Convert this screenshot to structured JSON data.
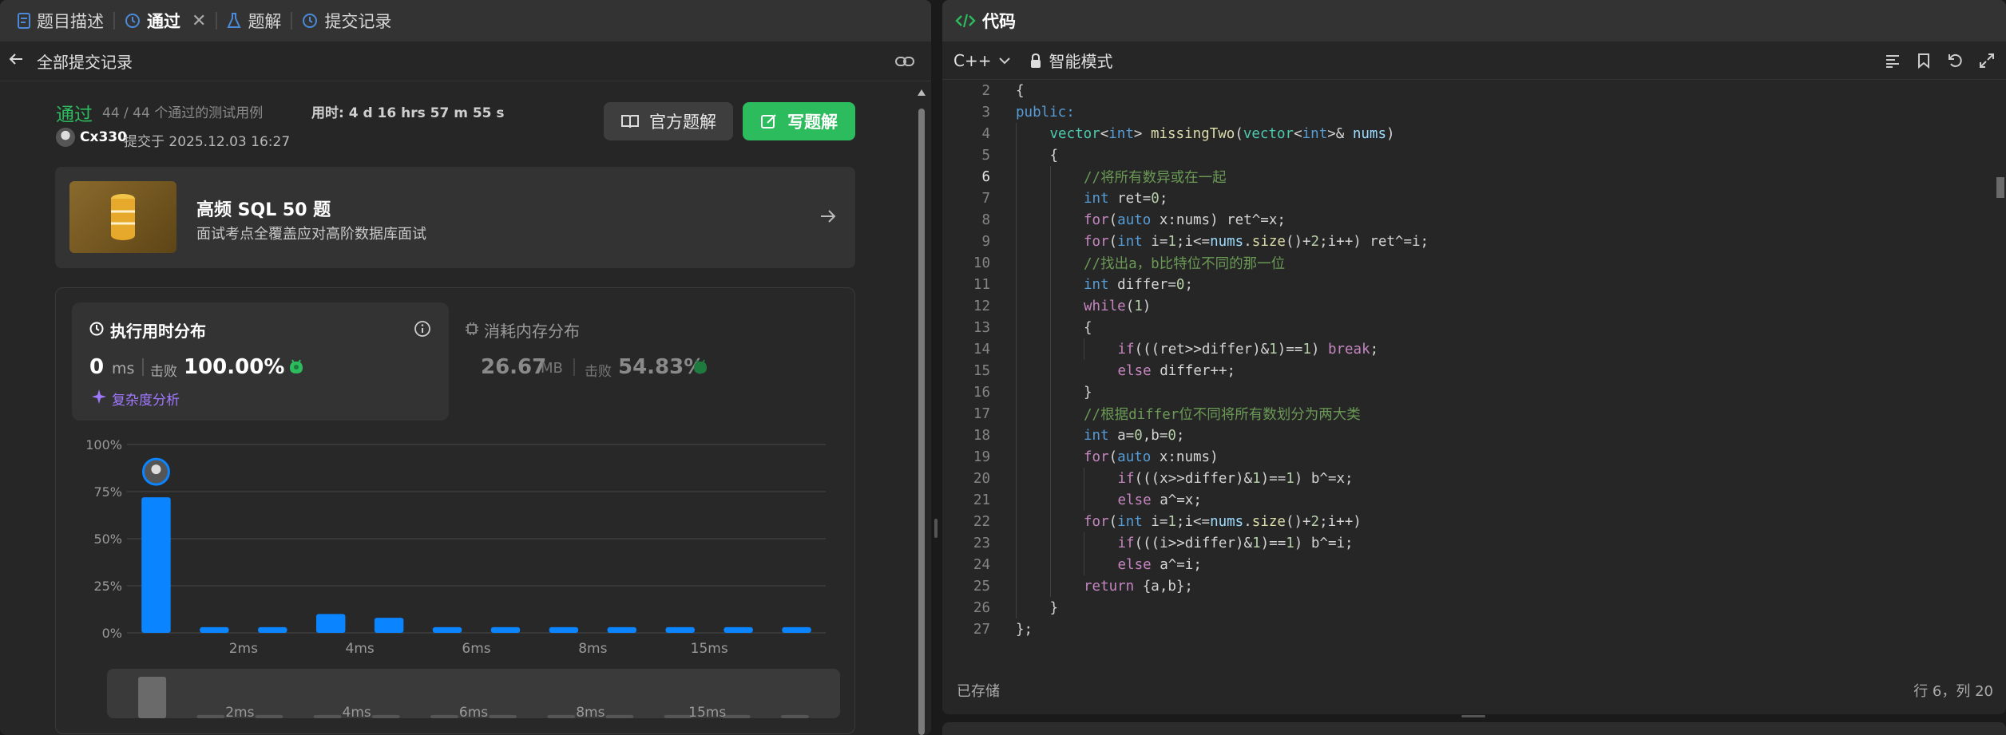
{
  "left_tabs": [
    {
      "label": "题目描述",
      "icon": "description-icon"
    },
    {
      "label": "通过",
      "icon": "history-icon",
      "active": true
    },
    {
      "label": "题解",
      "icon": "flask-icon"
    },
    {
      "label": "提交记录",
      "icon": "history-icon"
    }
  ],
  "sub_header": {
    "back_label": "全部提交记录"
  },
  "result": {
    "status": "通过",
    "cases": "44 / 44 个通过的测试用例",
    "time_taken": "用时: 4 d 16 hrs 57 m 55 s",
    "user": "Cx330",
    "submitted_at": "提交于 2025.12.03 16:27"
  },
  "buttons": {
    "official": "官方题解",
    "write": "写题解"
  },
  "promo": {
    "title": "高频 SQL 50 题",
    "desc": "面试考点全覆盖应对高阶数据库面试"
  },
  "runtime": {
    "title": "执行用时分布",
    "value": "0",
    "unit": "ms",
    "beats_label": "击败",
    "beats": "100.00%",
    "complexity": "复杂度分析"
  },
  "memory": {
    "title": "消耗内存分布",
    "value": "26.67",
    "unit": "MB",
    "beats_label": "击败",
    "beats": "54.83%"
  },
  "chart_data": {
    "type": "bar",
    "y_ticks": [
      "100%",
      "75%",
      "50%",
      "25%",
      "0%"
    ],
    "ylim": [
      0,
      100
    ],
    "values": [
      72,
      3,
      3,
      10,
      8,
      3,
      3,
      3,
      3,
      3,
      3,
      3
    ],
    "x_tick_labels": [
      "2ms",
      "4ms",
      "6ms",
      "8ms",
      "15ms"
    ],
    "x_tick_positions": [
      2,
      4,
      6,
      8,
      10
    ],
    "highlight_index": 0,
    "bar_color": "#0a84ff",
    "grid": true
  },
  "mini_chart": {
    "values": [
      100,
      8,
      8,
      8,
      8,
      8,
      8,
      8,
      8,
      8,
      8,
      8
    ],
    "x_tick_labels": [
      "2ms",
      "4ms",
      "6ms",
      "8ms",
      "15ms"
    ]
  },
  "code_panel": {
    "title": "代码",
    "language": "C++",
    "mode": "智能模式",
    "saved": "已存储",
    "cursor": "行 6，列 20"
  },
  "code_lines": [
    {
      "n": "2",
      "indent": 0,
      "segs": [
        [
          "{",
          "#d4d4d4"
        ]
      ]
    },
    {
      "n": "3",
      "indent": 0,
      "segs": [
        [
          "public:",
          "#569cd6"
        ]
      ]
    },
    {
      "n": "4",
      "indent": 1,
      "segs": [
        [
          "vector",
          "#4ec9b0"
        ],
        [
          "<",
          "#d4d4d4"
        ],
        [
          "int",
          "#569cd6"
        ],
        [
          "> ",
          "#d4d4d4"
        ],
        [
          "missingTwo",
          "#dcdcaa"
        ],
        [
          "(",
          "#d4d4d4"
        ],
        [
          "vector",
          "#4ec9b0"
        ],
        [
          "<",
          "#d4d4d4"
        ],
        [
          "int",
          "#569cd6"
        ],
        [
          ">& ",
          "#d4d4d4"
        ],
        [
          "nums",
          "#9cdcfe"
        ],
        [
          ")",
          "#d4d4d4"
        ]
      ]
    },
    {
      "n": "5",
      "indent": 1,
      "segs": [
        [
          "{",
          "#d4d4d4"
        ]
      ]
    },
    {
      "n": "6",
      "indent": 2,
      "active": true,
      "segs": [
        [
          "//将所有数异或在一起",
          "#6a9955"
        ]
      ]
    },
    {
      "n": "7",
      "indent": 2,
      "segs": [
        [
          "int",
          "#569cd6"
        ],
        [
          " ret=",
          "#d4d4d4"
        ],
        [
          "0",
          "#b5cea8"
        ],
        [
          ";",
          "#d4d4d4"
        ]
      ]
    },
    {
      "n": "8",
      "indent": 2,
      "segs": [
        [
          "for",
          "#c586c0"
        ],
        [
          "(",
          "#d4d4d4"
        ],
        [
          "auto",
          "#569cd6"
        ],
        [
          " x:nums) ret^=x;",
          "#d4d4d4"
        ]
      ]
    },
    {
      "n": "9",
      "indent": 2,
      "segs": [
        [
          "for",
          "#c586c0"
        ],
        [
          "(",
          "#d4d4d4"
        ],
        [
          "int",
          "#569cd6"
        ],
        [
          " i=",
          "#d4d4d4"
        ],
        [
          "1",
          "#b5cea8"
        ],
        [
          ";i<=",
          "#d4d4d4"
        ],
        [
          "nums",
          "#9cdcfe"
        ],
        [
          ".",
          "#d4d4d4"
        ],
        [
          "size",
          "#dcdcaa"
        ],
        [
          "()+",
          "#d4d4d4"
        ],
        [
          "2",
          "#b5cea8"
        ],
        [
          ";i++) ret^=i;",
          "#d4d4d4"
        ]
      ]
    },
    {
      "n": "10",
      "indent": 2,
      "segs": [
        [
          "//找出a，b比特位不同的那一位",
          "#6a9955"
        ]
      ]
    },
    {
      "n": "11",
      "indent": 2,
      "segs": [
        [
          "int",
          "#569cd6"
        ],
        [
          " differ=",
          "#d4d4d4"
        ],
        [
          "0",
          "#b5cea8"
        ],
        [
          ";",
          "#d4d4d4"
        ]
      ]
    },
    {
      "n": "12",
      "indent": 2,
      "segs": [
        [
          "while",
          "#c586c0"
        ],
        [
          "(",
          "#d4d4d4"
        ],
        [
          "1",
          "#b5cea8"
        ],
        [
          ")",
          "#d4d4d4"
        ]
      ]
    },
    {
      "n": "13",
      "indent": 2,
      "segs": [
        [
          "{",
          "#d4d4d4"
        ]
      ]
    },
    {
      "n": "14",
      "indent": 3,
      "segs": [
        [
          "if",
          "#c586c0"
        ],
        [
          "(((ret>>differ)&",
          "#d4d4d4"
        ],
        [
          "1",
          "#b5cea8"
        ],
        [
          ")==",
          "#d4d4d4"
        ],
        [
          "1",
          "#b5cea8"
        ],
        [
          ") ",
          "#d4d4d4"
        ],
        [
          "break",
          "#c586c0"
        ],
        [
          ";",
          "#d4d4d4"
        ]
      ]
    },
    {
      "n": "15",
      "indent": 3,
      "segs": [
        [
          "else",
          "#c586c0"
        ],
        [
          " differ++;",
          "#d4d4d4"
        ]
      ]
    },
    {
      "n": "16",
      "indent": 2,
      "segs": [
        [
          "}",
          "#d4d4d4"
        ]
      ]
    },
    {
      "n": "17",
      "indent": 2,
      "segs": [
        [
          "//根据differ位不同将所有数划分为两大类",
          "#6a9955"
        ]
      ]
    },
    {
      "n": "18",
      "indent": 2,
      "segs": [
        [
          "int",
          "#569cd6"
        ],
        [
          " a=",
          "#d4d4d4"
        ],
        [
          "0",
          "#b5cea8"
        ],
        [
          ",b=",
          "#d4d4d4"
        ],
        [
          "0",
          "#b5cea8"
        ],
        [
          ";",
          "#d4d4d4"
        ]
      ]
    },
    {
      "n": "19",
      "indent": 2,
      "segs": [
        [
          "for",
          "#c586c0"
        ],
        [
          "(",
          "#d4d4d4"
        ],
        [
          "auto",
          "#569cd6"
        ],
        [
          " x:nums)",
          "#d4d4d4"
        ]
      ]
    },
    {
      "n": "20",
      "indent": 3,
      "segs": [
        [
          "if",
          "#c586c0"
        ],
        [
          "(((x>>differ)&",
          "#d4d4d4"
        ],
        [
          "1",
          "#b5cea8"
        ],
        [
          ")==",
          "#d4d4d4"
        ],
        [
          "1",
          "#b5cea8"
        ],
        [
          ") b^=x;",
          "#d4d4d4"
        ]
      ]
    },
    {
      "n": "21",
      "indent": 3,
      "segs": [
        [
          "else",
          "#c586c0"
        ],
        [
          " a^=x;",
          "#d4d4d4"
        ]
      ]
    },
    {
      "n": "22",
      "indent": 2,
      "segs": [
        [
          "for",
          "#c586c0"
        ],
        [
          "(",
          "#d4d4d4"
        ],
        [
          "int",
          "#569cd6"
        ],
        [
          " i=",
          "#d4d4d4"
        ],
        [
          "1",
          "#b5cea8"
        ],
        [
          ";i<=",
          "#d4d4d4"
        ],
        [
          "nums",
          "#9cdcfe"
        ],
        [
          ".",
          "#d4d4d4"
        ],
        [
          "size",
          "#dcdcaa"
        ],
        [
          "()+",
          "#d4d4d4"
        ],
        [
          "2",
          "#b5cea8"
        ],
        [
          ";i++)",
          "#d4d4d4"
        ]
      ]
    },
    {
      "n": "23",
      "indent": 3,
      "segs": [
        [
          "if",
          "#c586c0"
        ],
        [
          "(((i>>differ)&",
          "#d4d4d4"
        ],
        [
          "1",
          "#b5cea8"
        ],
        [
          ")==",
          "#d4d4d4"
        ],
        [
          "1",
          "#b5cea8"
        ],
        [
          ") b^=i;",
          "#d4d4d4"
        ]
      ]
    },
    {
      "n": "24",
      "indent": 3,
      "segs": [
        [
          "else",
          "#c586c0"
        ],
        [
          " a^=i;",
          "#d4d4d4"
        ]
      ]
    },
    {
      "n": "25",
      "indent": 2,
      "segs": [
        [
          "return",
          "#c586c0"
        ],
        [
          " {a,b};",
          "#d4d4d4"
        ]
      ]
    },
    {
      "n": "26",
      "indent": 1,
      "segs": [
        [
          "}",
          "#d4d4d4"
        ]
      ]
    },
    {
      "n": "27",
      "indent": 0,
      "segs": [
        [
          "};",
          "#d4d4d4"
        ]
      ]
    }
  ]
}
